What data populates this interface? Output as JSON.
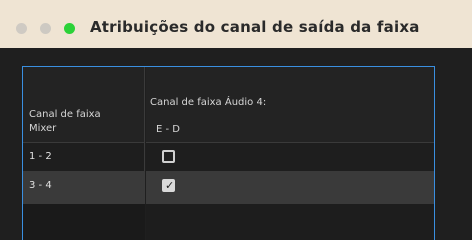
{
  "window": {
    "title": "Atribuições do canal de saída da faixa"
  },
  "table": {
    "left_header_line1": "Canal de faixa",
    "left_header_line2": "Mixer",
    "right_header_line1": "Canal de faixa Áudio 4:",
    "right_header_line2": "E - D",
    "rows": [
      {
        "label": "1 - 2",
        "checked": false
      },
      {
        "label": "3 - 4",
        "checked": true
      }
    ]
  }
}
